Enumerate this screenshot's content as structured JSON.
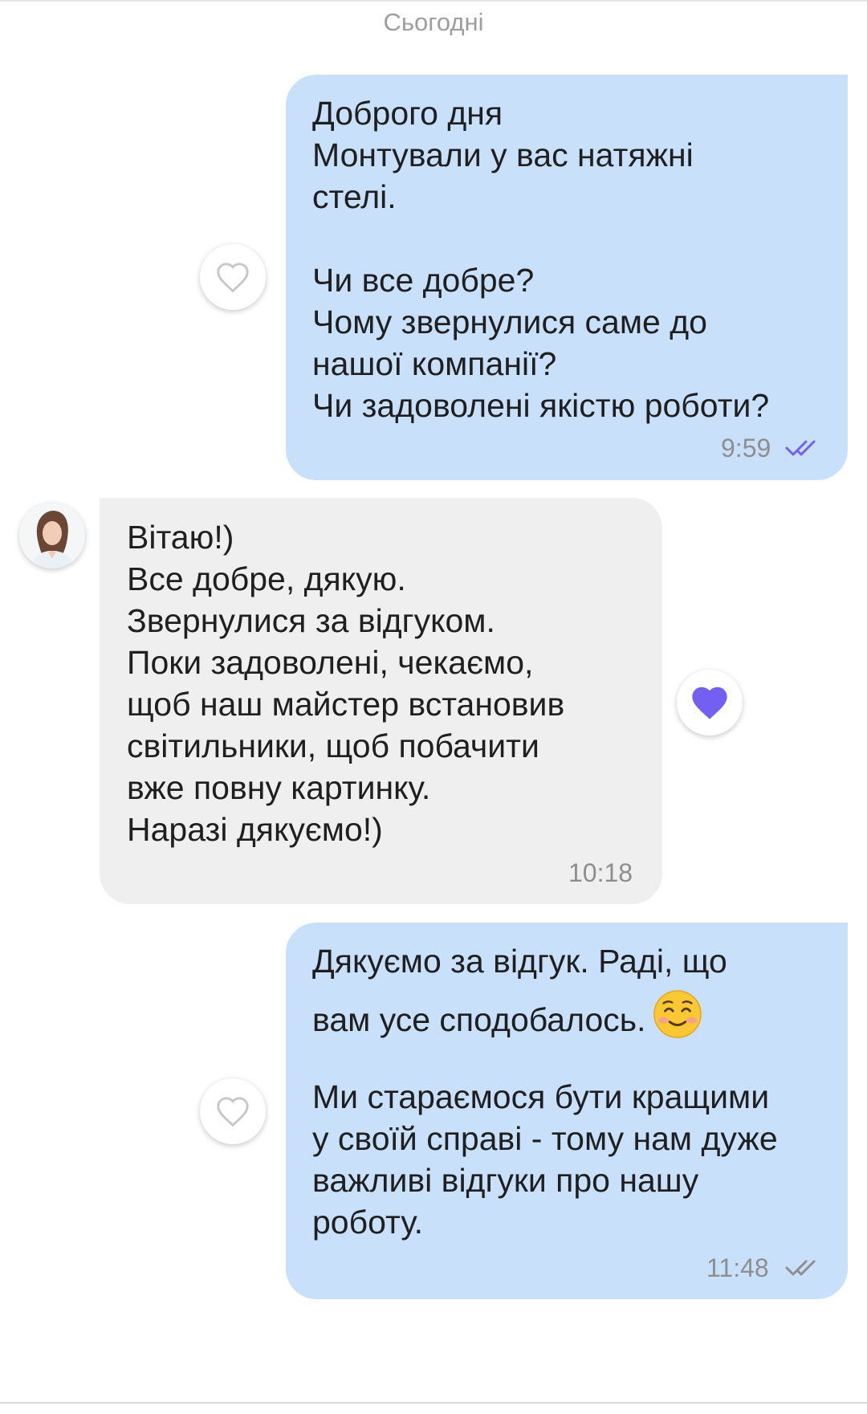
{
  "date_separator": "Сьогодні",
  "messages": [
    {
      "direction": "outgoing",
      "lines": "Доброго дня\nМонтували у вас натяжні\nстелі.\n\nЧи все добре?\nЧому звернулися саме до\nнашої компанії?\nЧи задоволені якістю роботи?",
      "time": "9:59",
      "read_status": "read",
      "liked": false
    },
    {
      "direction": "incoming",
      "lines": "Вітаю!)\nВсе добре, дякую.\nЗвернулися за відгуком.\nПоки задоволені, чекаємо,\nщоб наш майстер встановив\nсвітильники, щоб побачити\nвже повну картинку.\nНаразі дякуємо!)",
      "time": "10:18",
      "liked": true
    },
    {
      "direction": "outgoing",
      "line1": "Дякуємо за відгук. Раді, що",
      "line2": "вам усе сподобалось.",
      "emoji": "smiling-face-icon",
      "lines_rest": "Ми стараємося бути кращими\nу своїй справі - тому нам дуже\nважливі відгуки про нашу\nроботу.",
      "time": "11:48",
      "read_status": "delivered",
      "liked": false
    }
  ],
  "colors": {
    "outgoing_bubble": "#c9e0fa",
    "incoming_bubble": "#efefef",
    "read_ticks": "#7360f2",
    "delivered_ticks": "#8e8e8e",
    "like_active": "#7360f2"
  }
}
